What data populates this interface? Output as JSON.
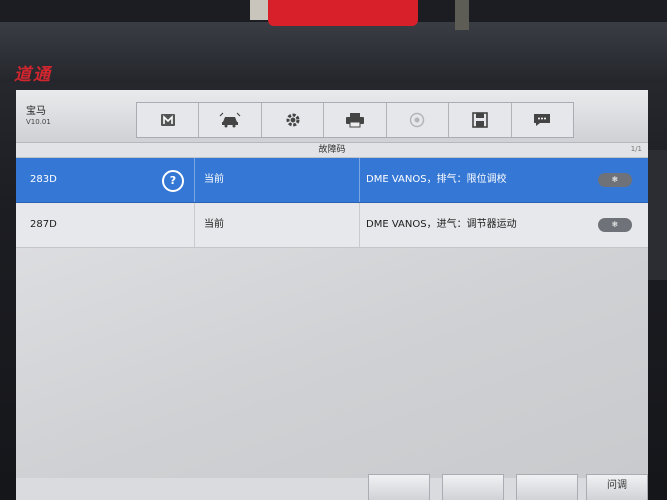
{
  "device": {
    "brand": "道通"
  },
  "header": {
    "vehicle_name": "宝马",
    "version": "V10.01",
    "toolbar_icons": [
      "home-icon",
      "vehicle-swap-icon",
      "settings-icon",
      "print-icon",
      "help-icon",
      "save-icon",
      "message-icon"
    ]
  },
  "section": {
    "title": "故障码",
    "page_indicator": "1/1"
  },
  "dtc_rows": [
    {
      "code": "283D",
      "status": "当前",
      "description": "DME VANOS，排气：限位调校",
      "freeze_label": "❄",
      "selected": true
    },
    {
      "code": "287D",
      "status": "当前",
      "description": "DME VANOS，进气：调节器运动",
      "freeze_label": "❄",
      "selected": false
    }
  ],
  "footer": {
    "button_4_label": "问调"
  },
  "colors": {
    "selected_row": "#3577d4",
    "brand_red": "#d2262e"
  }
}
